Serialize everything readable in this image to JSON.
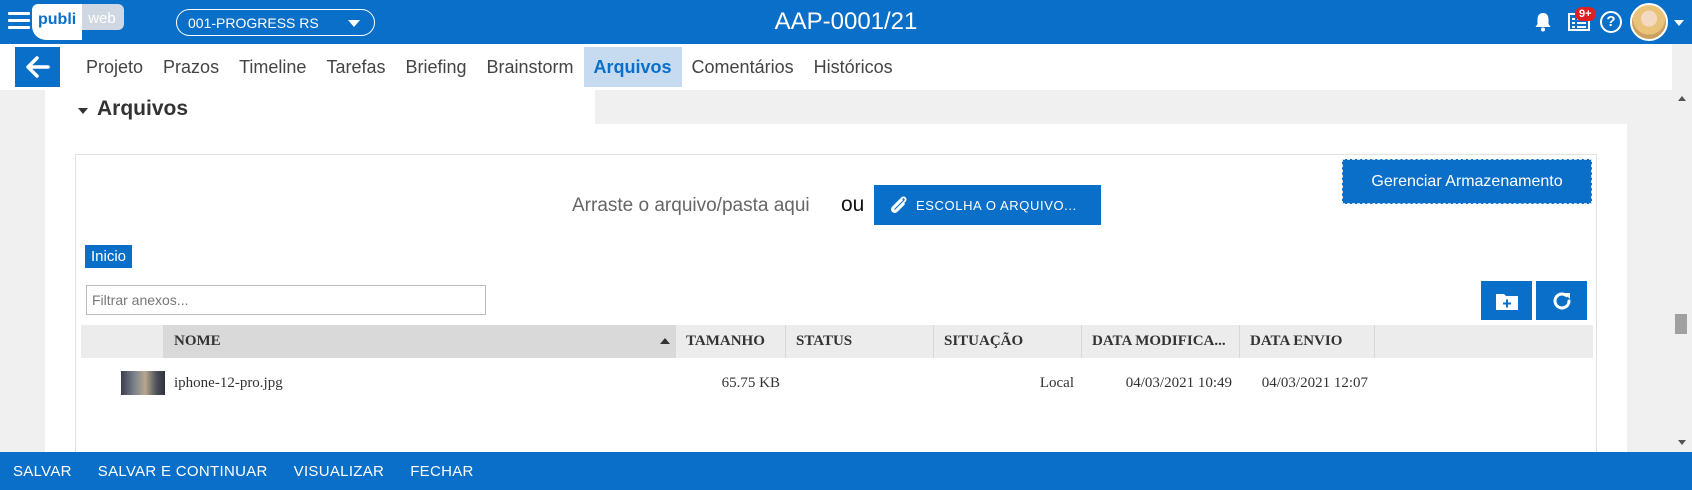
{
  "header": {
    "logo_left": "publi",
    "logo_right": "web",
    "project_select": "001-PROGRESS RS",
    "title": "AAP-0001/21",
    "notification_badge": "9+"
  },
  "tabs": [
    {
      "label": "Projeto"
    },
    {
      "label": "Prazos"
    },
    {
      "label": "Timeline"
    },
    {
      "label": "Tarefas"
    },
    {
      "label": "Briefing"
    },
    {
      "label": "Brainstorm"
    },
    {
      "label": "Arquivos",
      "active": true
    },
    {
      "label": "Comentários"
    },
    {
      "label": "Históricos"
    }
  ],
  "section": {
    "title": "Arquivos"
  },
  "upload": {
    "drop_text": "Arraste o arquivo/pasta aqui",
    "or_text": "ou",
    "choose_label": "ESCOLHA O ARQUIVO...",
    "manage_label": "Gerenciar Armazenamento"
  },
  "breadcrumb": "Inicio",
  "filter": {
    "placeholder": "Filtrar anexos...",
    "value": ""
  },
  "table": {
    "columns": [
      "NOME",
      "TAMANHO",
      "STATUS",
      "SITUAÇÃO",
      "DATA  MODIFICA...",
      "DATA  ENVIO"
    ],
    "rows": [
      {
        "name": "iphone-12-pro.jpg",
        "size": "65.75  KB",
        "status": "",
        "situation": "Local",
        "modified": "04/03/2021  10:49",
        "sent": "04/03/2021  12:07"
      }
    ]
  },
  "footer": {
    "save": "SALVAR",
    "save_continue": "SALVAR E CONTINUAR",
    "preview": "VISUALIZAR",
    "close": "FECHAR"
  },
  "colors": {
    "primary": "#0a6fc9",
    "tab_active_bg": "#c6daf0",
    "badge": "#e02020"
  }
}
